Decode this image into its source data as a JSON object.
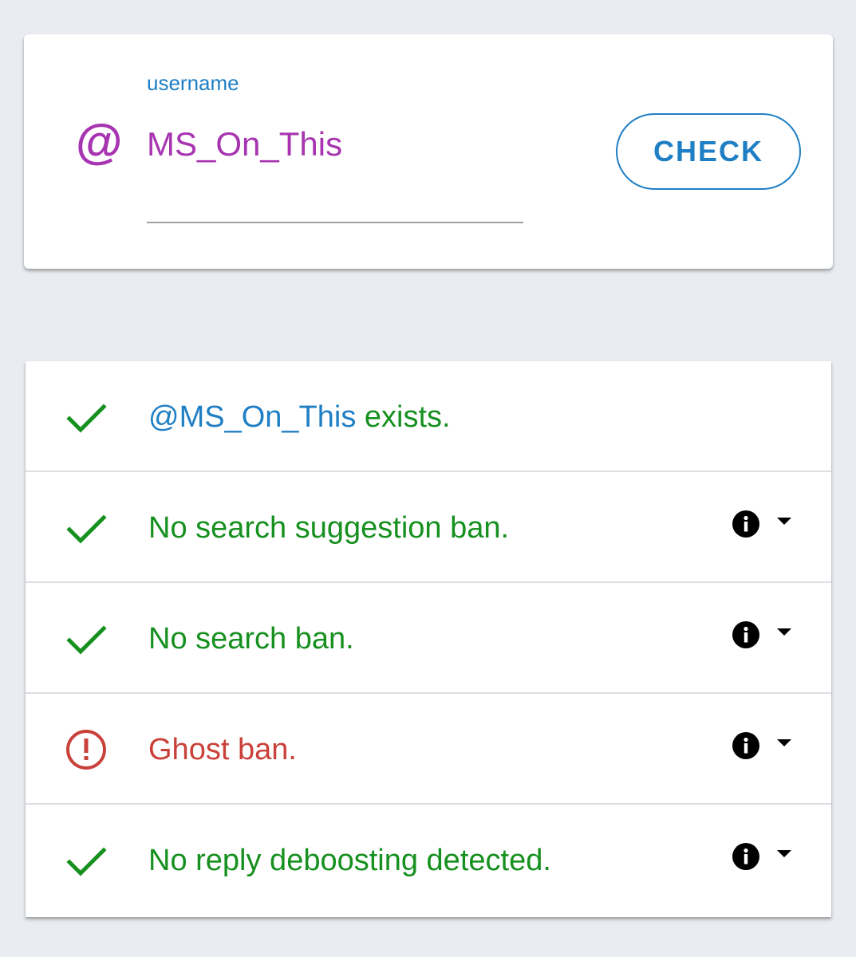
{
  "search": {
    "label": "username",
    "at_symbol": "@",
    "value": "MS_On_This",
    "check_label": "CHECK"
  },
  "colors": {
    "accent_blue": "#1f7fc4",
    "purple": "#a734b0",
    "success_green": "#16901f",
    "error_red": "#c9413a"
  },
  "results": [
    {
      "status": "ok",
      "status_icon": "check-icon",
      "handle": "@MS_On_This",
      "text": " exists.",
      "has_info": false
    },
    {
      "status": "ok",
      "status_icon": "check-icon",
      "text": "No search suggestion ban.",
      "has_info": true
    },
    {
      "status": "ok",
      "status_icon": "check-icon",
      "text": "No search ban.",
      "has_info": true
    },
    {
      "status": "error",
      "status_icon": "alert-circle-icon",
      "text": "Ghost ban.",
      "has_info": true
    },
    {
      "status": "ok",
      "status_icon": "check-icon",
      "text": "No reply deboosting detected.",
      "has_info": true
    }
  ]
}
